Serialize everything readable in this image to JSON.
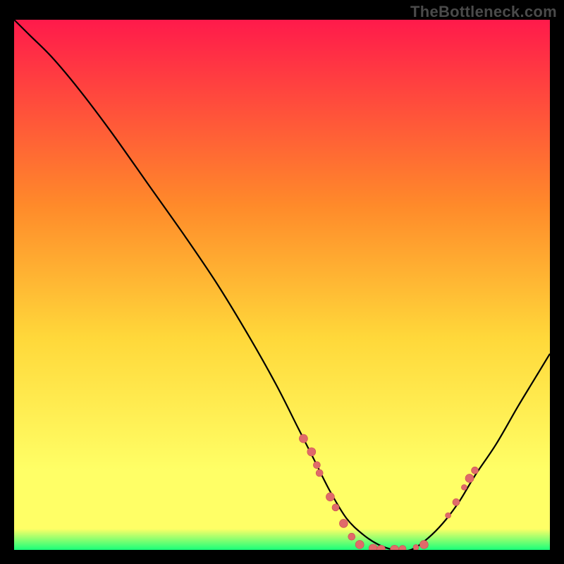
{
  "watermark": "TheBottleneck.com",
  "colors": {
    "background": "#000000",
    "gradient_top": "#ff1a4b",
    "gradient_mid_upper": "#ff8a2a",
    "gradient_mid": "#ffd83a",
    "gradient_lower": "#ffff66",
    "gradient_bottom": "#19ff7a",
    "curve": "#000000",
    "marker_fill": "#e06a6a",
    "marker_stroke": "#c94f4f"
  },
  "chart_data": {
    "type": "line",
    "title": "",
    "xlabel": "",
    "ylabel": "",
    "xlim": [
      0,
      100
    ],
    "ylim": [
      0,
      100
    ],
    "curve": {
      "x": [
        0,
        3,
        7,
        12,
        18,
        25,
        32,
        38,
        44,
        49,
        53,
        56,
        59,
        62,
        65,
        68,
        71,
        74,
        77,
        80,
        83,
        86,
        90,
        94,
        97,
        100
      ],
      "y": [
        100,
        97,
        93,
        87,
        79,
        69,
        59,
        50,
        40,
        31,
        23,
        17,
        11,
        6,
        3,
        1,
        0,
        0,
        2,
        5,
        9,
        14,
        20,
        27,
        32,
        37
      ]
    },
    "markers": [
      {
        "x": 54.0,
        "y": 21.0,
        "r": 6
      },
      {
        "x": 55.5,
        "y": 18.5,
        "r": 6
      },
      {
        "x": 56.5,
        "y": 16.0,
        "r": 5
      },
      {
        "x": 57.0,
        "y": 14.5,
        "r": 5
      },
      {
        "x": 59.0,
        "y": 10.0,
        "r": 6
      },
      {
        "x": 60.0,
        "y": 8.0,
        "r": 5
      },
      {
        "x": 61.5,
        "y": 5.0,
        "r": 6
      },
      {
        "x": 63.0,
        "y": 2.5,
        "r": 5
      },
      {
        "x": 64.5,
        "y": 1.0,
        "r": 6
      },
      {
        "x": 67.0,
        "y": 0.3,
        "r": 6
      },
      {
        "x": 68.5,
        "y": 0.1,
        "r": 6
      },
      {
        "x": 71.0,
        "y": 0.1,
        "r": 6
      },
      {
        "x": 72.5,
        "y": 0.2,
        "r": 5
      },
      {
        "x": 75.0,
        "y": 0.5,
        "r": 4
      },
      {
        "x": 76.5,
        "y": 1.0,
        "r": 6
      },
      {
        "x": 81.0,
        "y": 6.5,
        "r": 4
      },
      {
        "x": 82.5,
        "y": 9.0,
        "r": 5
      },
      {
        "x": 84.0,
        "y": 11.8,
        "r": 4
      },
      {
        "x": 85.0,
        "y": 13.5,
        "r": 6
      },
      {
        "x": 86.0,
        "y": 15.0,
        "r": 5
      }
    ]
  }
}
